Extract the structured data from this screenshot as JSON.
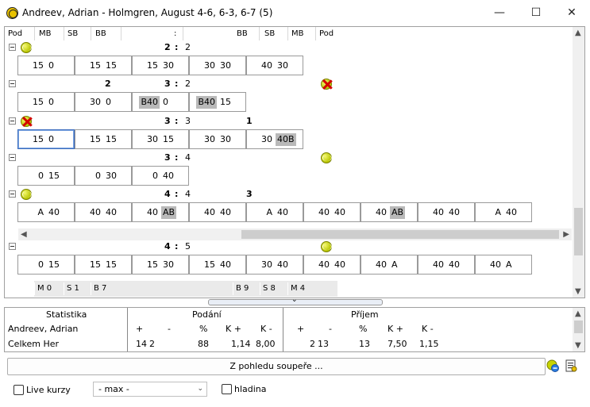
{
  "window": {
    "title": "Andreev, Adrian - Holmgren, August 4-6, 6-3, 6-7 (5)",
    "minimize": "—",
    "maximize": "☐",
    "close": "✕"
  },
  "grid": {
    "headers": [
      "Pod",
      "MB",
      "SB",
      "BB",
      ":",
      "BB",
      "SB",
      "MB",
      "Pod"
    ],
    "sets": [
      {
        "score_left": "2",
        "score_sep": ":",
        "score_right": "2",
        "bold_left": "",
        "bold_right": "",
        "server": "left",
        "games": [
          [
            "15",
            "0"
          ],
          [
            "15",
            "15"
          ],
          [
            "15",
            "30"
          ],
          [
            "30",
            "30"
          ],
          [
            "40",
            "30"
          ]
        ]
      },
      {
        "score_left": "3",
        "score_sep": ":",
        "score_right": "2",
        "bold_left": "2",
        "bold_right": "",
        "server": "right-x",
        "games": [
          [
            "15",
            "0"
          ],
          [
            "30",
            "0"
          ],
          [
            "B40",
            "0"
          ],
          [
            "B40",
            "15"
          ]
        ]
      },
      {
        "score_left": "3",
        "score_sep": ":",
        "score_right": "3",
        "bold_left": "",
        "bold_right": "1",
        "server": "left-x",
        "games": [
          [
            "15",
            "0"
          ],
          [
            "15",
            "15"
          ],
          [
            "30",
            "15"
          ],
          [
            "30",
            "30"
          ],
          [
            "30",
            "40B"
          ]
        ]
      },
      {
        "score_left": "3",
        "score_sep": ":",
        "score_right": "4",
        "bold_left": "",
        "bold_right": "",
        "server": "right",
        "games": [
          [
            "0",
            "15"
          ],
          [
            "0",
            "30"
          ],
          [
            "0",
            "40"
          ]
        ]
      },
      {
        "score_left": "4",
        "score_sep": ":",
        "score_right": "4",
        "bold_left": "",
        "bold_right": "3",
        "server": "left",
        "games": [
          [
            "A",
            "40"
          ],
          [
            "40",
            "40"
          ],
          [
            "40",
            "AB"
          ],
          [
            "40",
            "40"
          ],
          [
            "A",
            "40"
          ],
          [
            "40",
            "40"
          ],
          [
            "40",
            "AB"
          ],
          [
            "40",
            "40"
          ],
          [
            "A",
            "40"
          ]
        ]
      },
      {
        "score_left": "4",
        "score_sep": ":",
        "score_right": "5",
        "bold_left": "",
        "bold_right": "",
        "server": "right",
        "games": [
          [
            "0",
            "15"
          ],
          [
            "15",
            "15"
          ],
          [
            "15",
            "30"
          ],
          [
            "15",
            "40"
          ],
          [
            "30",
            "40"
          ],
          [
            "40",
            "40"
          ],
          [
            "40",
            "A"
          ],
          [
            "40",
            "40"
          ],
          [
            "40",
            "A"
          ]
        ]
      }
    ],
    "footer": {
      "left": [
        "M 0",
        "S 1",
        "B 7"
      ],
      "right": [
        "B 9",
        "S 8",
        "M 4"
      ]
    }
  },
  "stats": {
    "col_label": "Statistika",
    "group_serve": "Podání",
    "group_return": "Příjem",
    "player": "Andreev, Adrian",
    "cols_serve": [
      "+",
      "-",
      "%",
      "K +",
      "K -"
    ],
    "cols_return": [
      "+",
      "-",
      "%",
      "K +",
      "K -"
    ],
    "row_label": "Celkem Her",
    "serve_values": [
      "14",
      "2",
      "88",
      "1,14",
      "8,00"
    ],
    "return_values": [
      "2",
      "13",
      "13",
      "7,50",
      "1,15"
    ]
  },
  "controls": {
    "opponent_view": "Z pohledu soupeře ...",
    "live_odds": "Live kurzy",
    "combo_value": "- max -",
    "level": "hladina"
  }
}
